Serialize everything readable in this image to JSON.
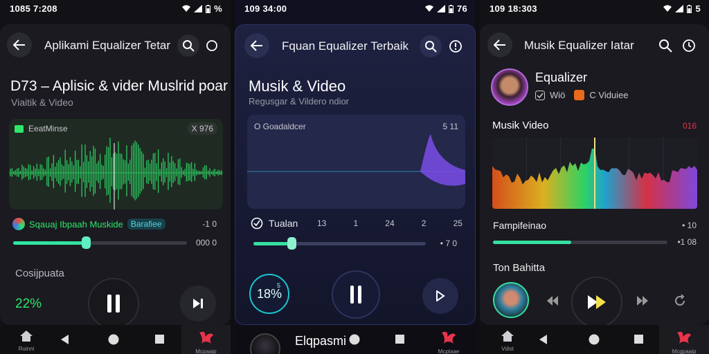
{
  "colors": {
    "green": "#2ee66b",
    "teal": "#36e0a0",
    "cyan": "#19d3e0",
    "purple": "#8a4df0",
    "red": "#e8344a"
  },
  "screen1": {
    "status_time": "1085 7:208",
    "status_battery": "%",
    "header_title": "Aplikami Equalizer Tetar",
    "title": "D73 – Aplisic & vider Muslrid poar",
    "subtitle": "Viaitik & Video",
    "wave_label": "EeatMinse",
    "wave_meta": "X 976",
    "track_name": "Sqauaj Ibpaah Muskide",
    "track_badge": "Barafiee",
    "track_time_right": "-1 0",
    "progress": 0.42,
    "progress_right": "000 0",
    "section_label": "Cosijpuata",
    "percent": "22%",
    "nav_home_label": "Ruinni",
    "nav_brand_label": "Mcpaaip"
  },
  "screen2": {
    "status_time": "109 34:00",
    "status_battery": "76",
    "header_title": "Fquan Equalizer Terbaik",
    "title": "Musik & Video",
    "subtitle": "Regusgar & Vildero ndior",
    "wave_label": "O Goadaldcer",
    "wave_meta": "5 11",
    "row_label": "Tualan",
    "row_values": [
      "13",
      "1",
      "24",
      "2",
      "25"
    ],
    "progress": 0.22,
    "progress_right": "• 7 0",
    "badge_value": "18%",
    "badge_sup": "5",
    "bottom_title": "Elqpasmi",
    "nav_brand_label": "Mcptaae"
  },
  "screen3": {
    "status_time": "109 18:303",
    "status_battery": "5",
    "header_title": "Musik Equalizer Iatar",
    "profile_title": "Equalizer",
    "profile_tags": [
      "Wiö",
      "C Viduiee"
    ],
    "section_title": "Musik Video",
    "section_meta": "016",
    "row_label": "Fampifeinao",
    "row_right": "• 10",
    "progress": 0.45,
    "progress_right": "•1 08",
    "now_label": "Ton Bahitta",
    "nav_home_label": "Vdist",
    "nav_brand_label": "Mcgpaaip"
  }
}
